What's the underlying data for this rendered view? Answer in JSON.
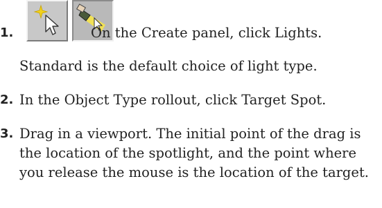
{
  "steps": [
    {
      "number": "1.",
      "icons": [
        "create-panel-icon",
        "lights-icon"
      ],
      "text": "On the Create panel, click Lights.",
      "note": "Standard is the default choice of light type."
    },
    {
      "number": "2.",
      "text": "In the Object Type rollout, click Target Spot."
    },
    {
      "number": "3.",
      "text": "Drag in a viewport. The initial point of the drag is the location of the spotlight, and the point where you release the mouse is the location of the target."
    }
  ],
  "colors": {
    "text": "#222222",
    "button_face": "#c8c8c8",
    "star_yellow": "#f2d21e",
    "light_yellow": "#f7e64a"
  }
}
